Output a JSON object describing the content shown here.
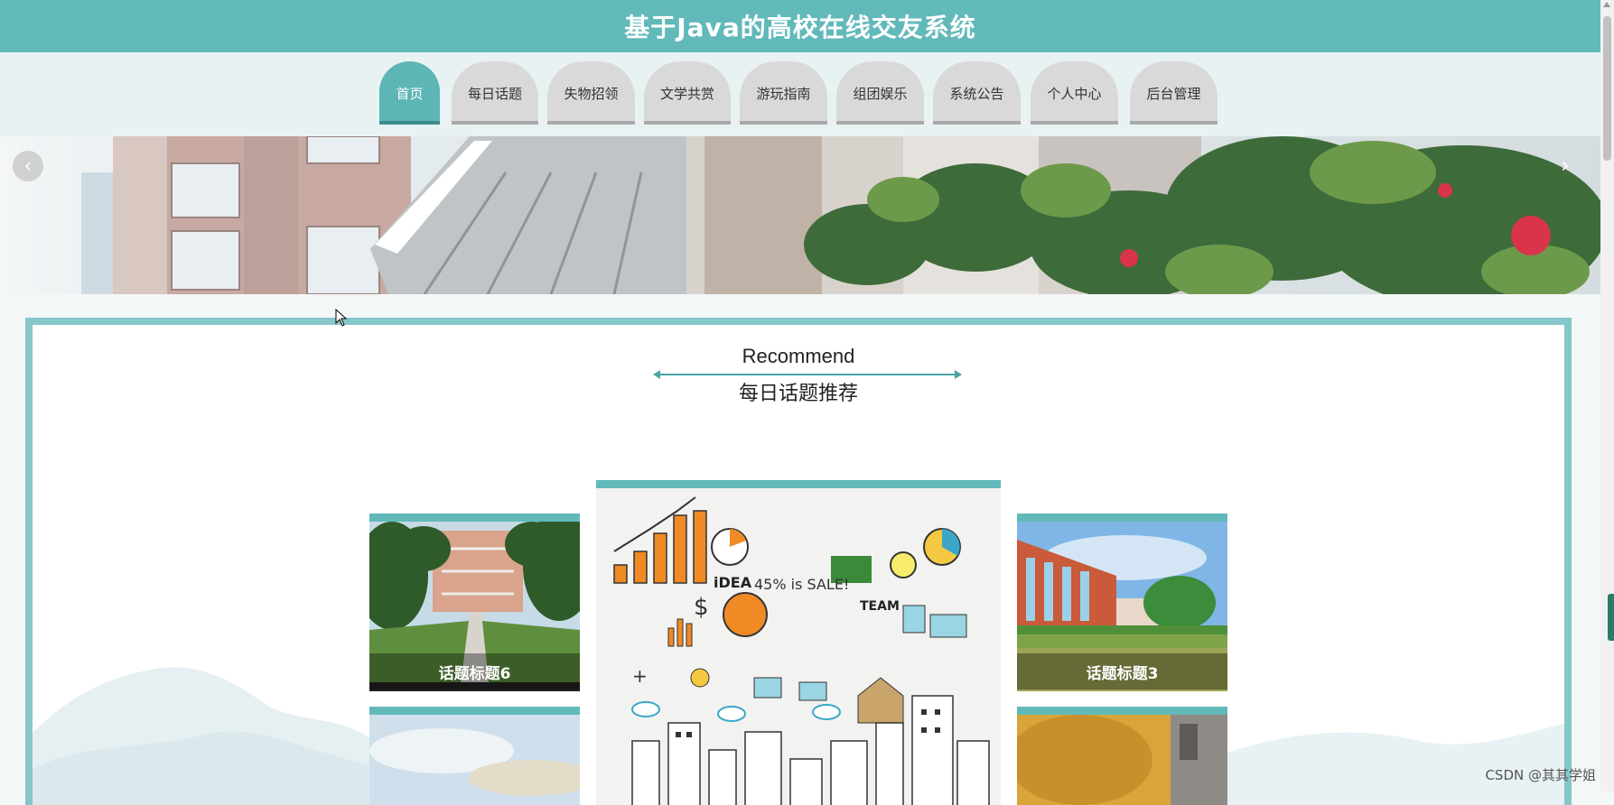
{
  "header": {
    "title": "基于Java的高校在线交友系统"
  },
  "nav": {
    "items": [
      {
        "label": "首页",
        "active": true
      },
      {
        "label": "每日话题",
        "active": false
      },
      {
        "label": "失物招领",
        "active": false
      },
      {
        "label": "文学共赏",
        "active": false
      },
      {
        "label": "游玩指南",
        "active": false
      },
      {
        "label": "组团娱乐",
        "active": false
      },
      {
        "label": "系统公告",
        "active": false
      },
      {
        "label": "个人中心",
        "active": false
      },
      {
        "label": "后台管理",
        "active": false
      }
    ]
  },
  "banner": {
    "prev_icon": "chevron-left-icon",
    "next_icon": "chevron-right-icon"
  },
  "recommend": {
    "title_en": "Recommend",
    "title_cn": "每日话题推荐",
    "cards": [
      {
        "caption": "话题标题6"
      },
      {
        "caption": ""
      },
      {
        "caption": "话题标题3"
      }
    ]
  },
  "watermark": "CSDN @其其学姐",
  "colors": {
    "accent": "#62b9ba",
    "border": "#86c7c9"
  }
}
